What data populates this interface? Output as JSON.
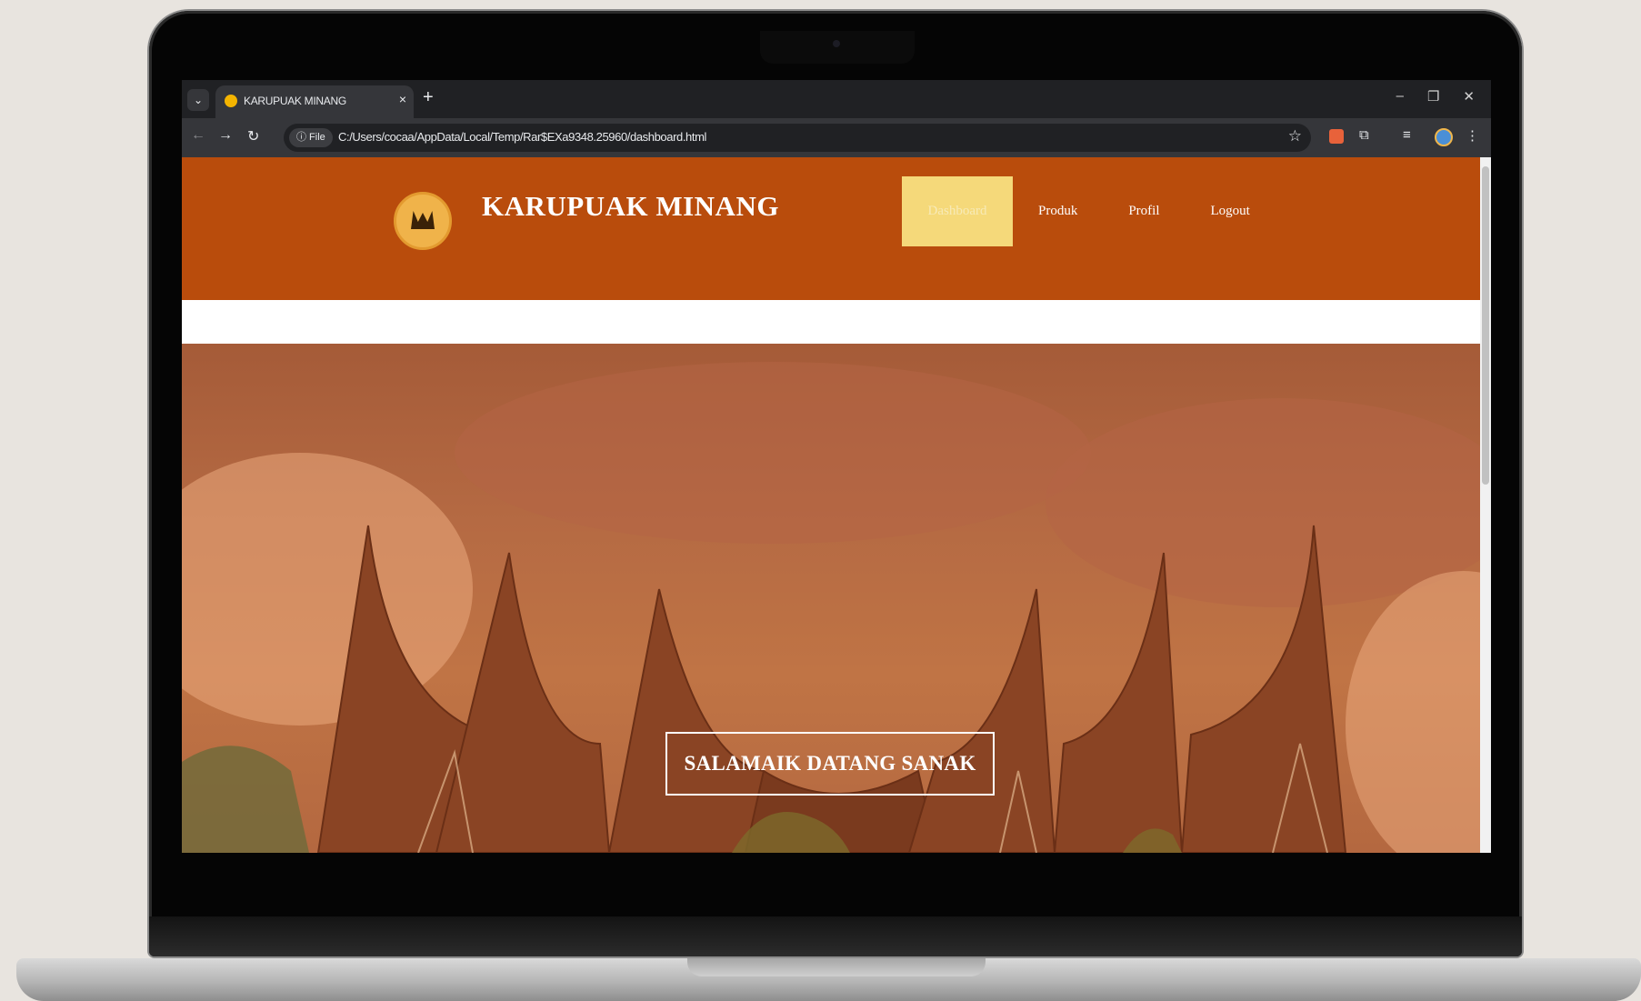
{
  "browser": {
    "tab_title": "KARUPUAK MINANG",
    "tab_close": "×",
    "new_tab": "+",
    "file_chip": "ⓘ File",
    "url": "C:/Users/cocaa/AppData/Local/Temp/Rar$EXa9348.25960/dashboard.html"
  },
  "site": {
    "title": "KARUPUAK MINANG",
    "menu": [
      "Dashboard",
      "Produk",
      "Profil",
      "Logout"
    ],
    "active_menu": "Dashboard"
  },
  "hero": {
    "button_label": "SALAMAIK DATANG SANAK"
  },
  "colors": {
    "header": "#b94c0c",
    "active_menu": "#f5d97a",
    "hero_tint": "#b56a43"
  }
}
